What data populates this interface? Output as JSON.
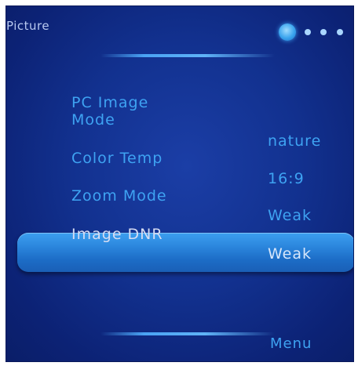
{
  "header": {
    "title": "Picture",
    "page_indicator": {
      "current_page": 1,
      "total_pages": 4
    }
  },
  "menu_items": [
    {
      "label": "PC Image Mode"
    },
    {
      "label": "Color Temp"
    },
    {
      "label": "Zoom Mode"
    },
    {
      "label": "Image DNR"
    }
  ],
  "values": [
    "nature",
    "16:9",
    "Weak",
    "Weak"
  ],
  "footer": {
    "menu_label": "Menu"
  },
  "colors": {
    "background": "#12318f",
    "label_text": "#3ea3f2",
    "selected_text": "#d6dcf2",
    "highlight_bar": "#2b86dd"
  }
}
